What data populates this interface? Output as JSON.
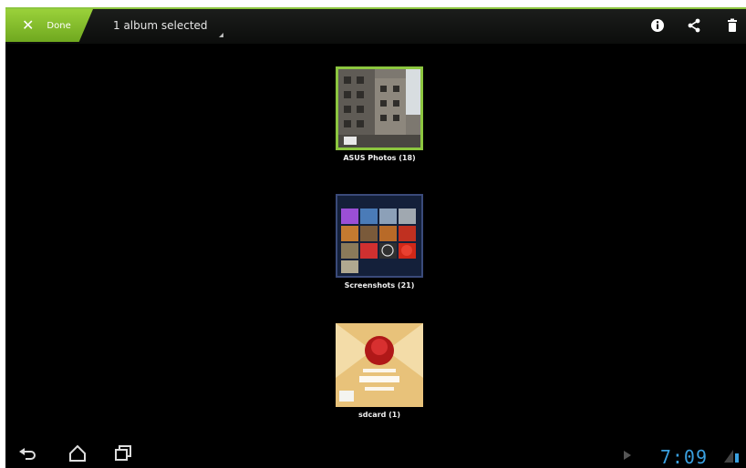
{
  "action_bar": {
    "done_label": "Done",
    "selection_text": "1 album selected",
    "icons": [
      "info-icon",
      "share-icon",
      "delete-icon"
    ]
  },
  "albums": [
    {
      "label": "ASUS Photos (18)"
    },
    {
      "label": "Screenshots (21)"
    },
    {
      "label": "sdcard (1)"
    }
  ],
  "status_bar": {
    "time": "7:09"
  },
  "colors": {
    "accent": "#8cc63f",
    "clock": "#3aa0e0",
    "background": "#000000"
  }
}
